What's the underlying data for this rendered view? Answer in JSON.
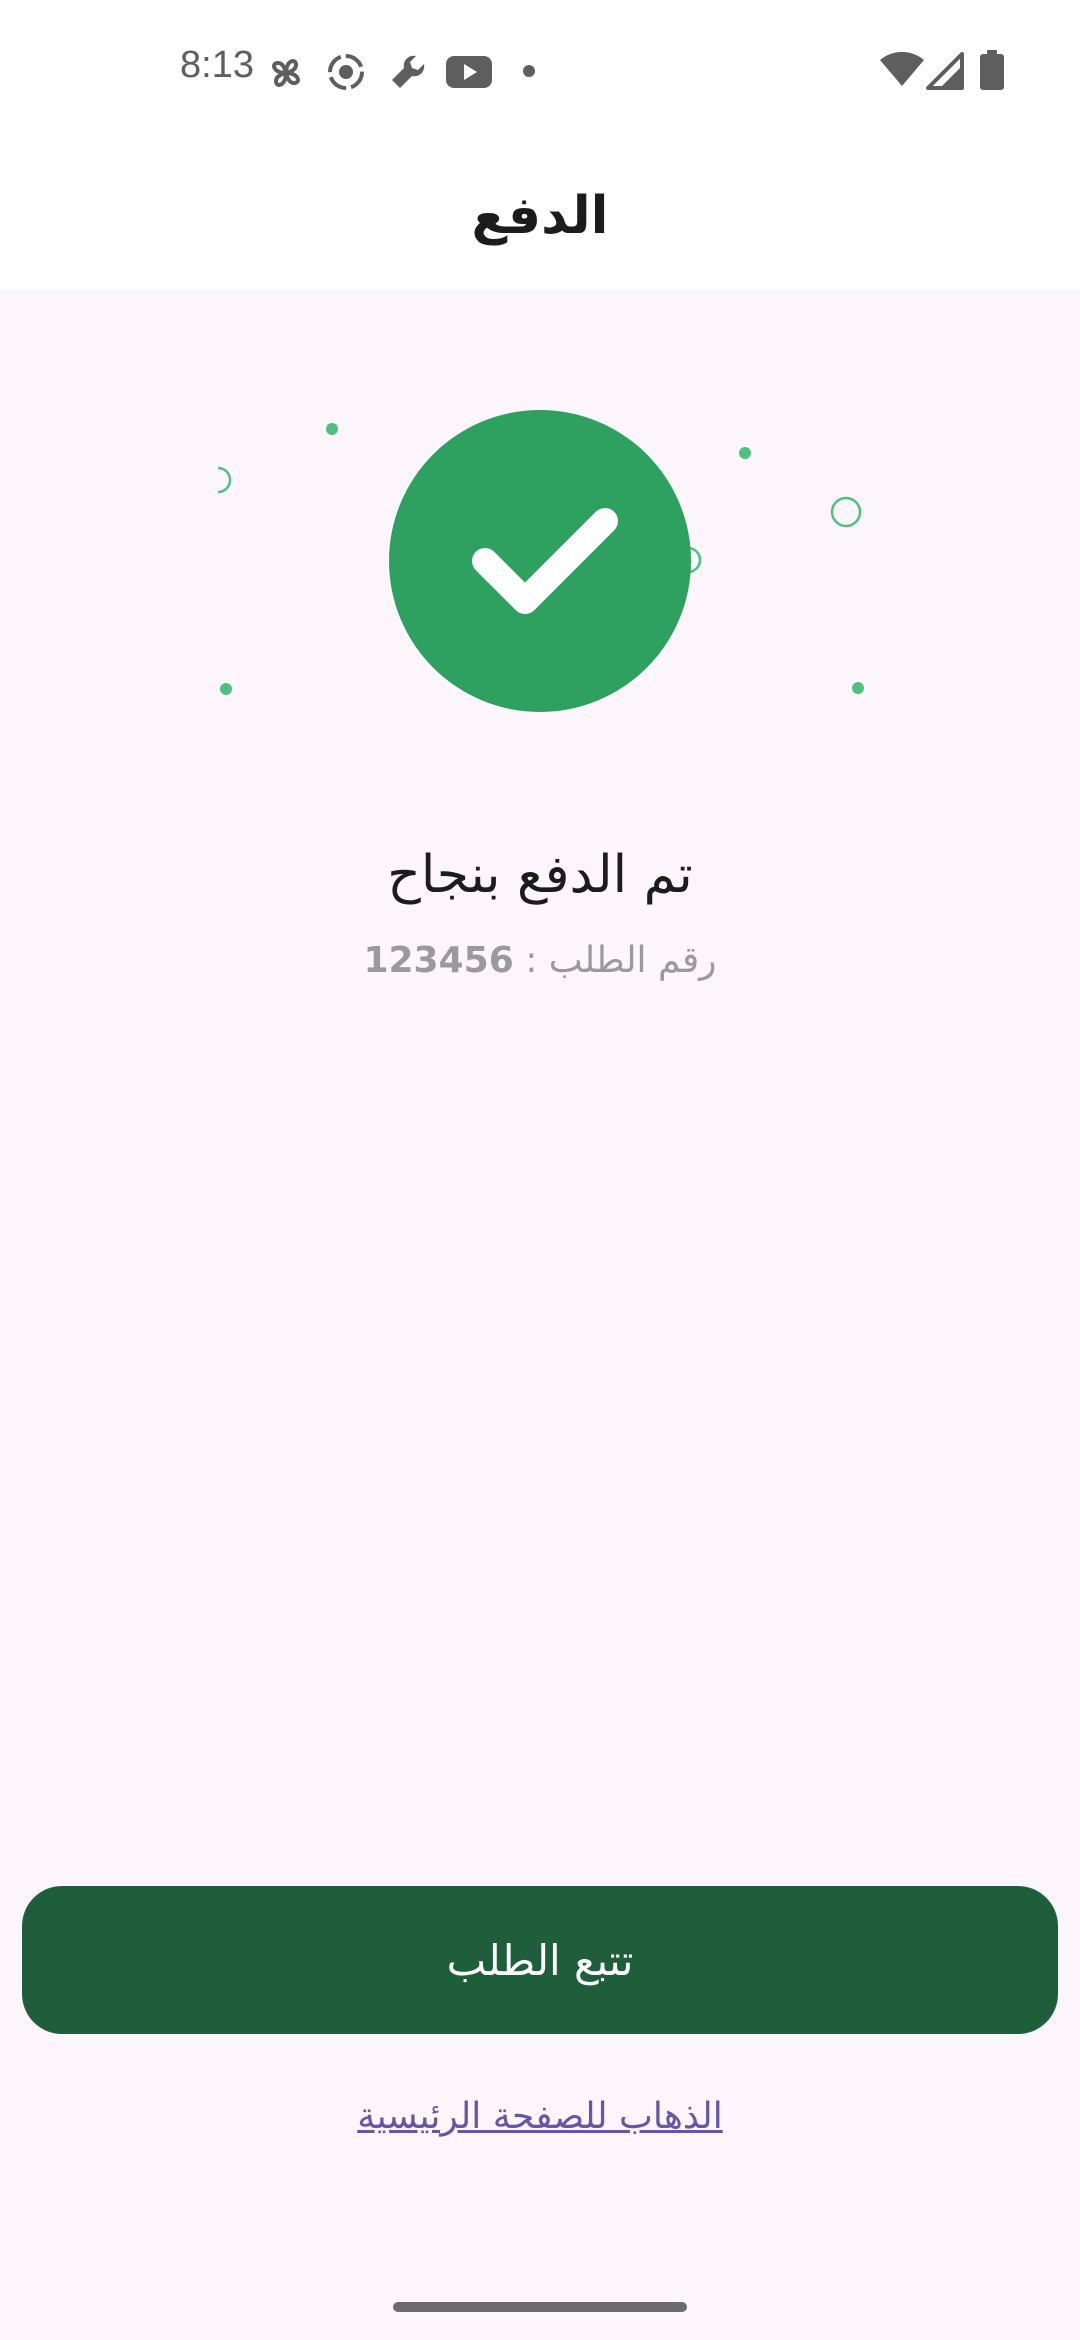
{
  "status_bar": {
    "time": "8:13",
    "icons": [
      "fan-icon",
      "record-icon",
      "wrench-icon",
      "youtube-icon",
      "dot-icon",
      "wifi-icon",
      "signal-icon",
      "battery-icon"
    ]
  },
  "app_bar": {
    "title": "الدفع"
  },
  "main": {
    "success_icon": "check-circle-icon",
    "headline": "تم الدفع بنجاح",
    "order_label": "رقم الطلب : ",
    "order_number": "123456",
    "track_button_label": "تتبع الطلب",
    "home_link_label": "الذهاب للصفحة الرئيسية"
  },
  "colors": {
    "success_green": "#2EA160",
    "button_green": "#1F5E3B",
    "link_purple": "#6656A6",
    "background": "#FCF5FC"
  }
}
